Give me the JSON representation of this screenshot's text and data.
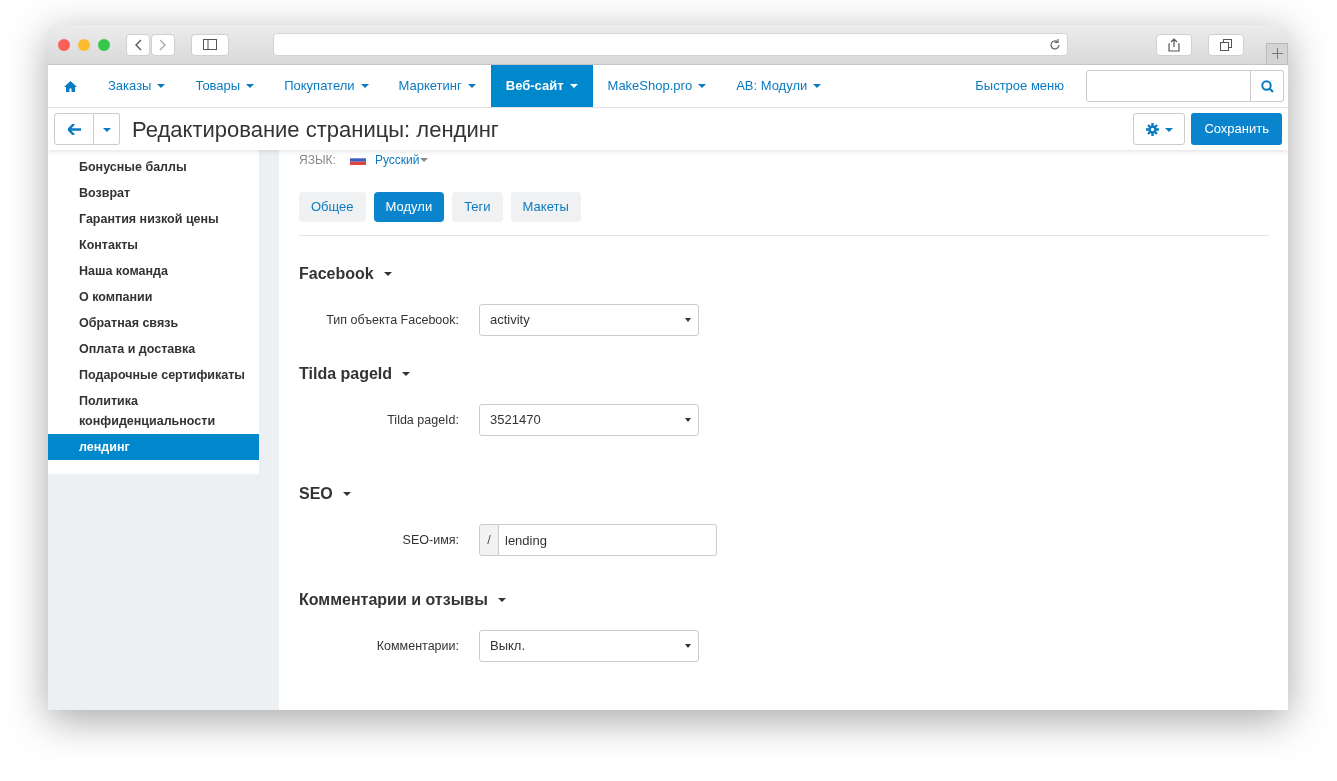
{
  "nav": {
    "items": [
      {
        "label": "Заказы",
        "selected": false
      },
      {
        "label": "Товары",
        "selected": false
      },
      {
        "label": "Покупатели",
        "selected": false
      },
      {
        "label": "Маркетинг",
        "selected": false
      },
      {
        "label": "Веб-сайт",
        "selected": true
      },
      {
        "label": "MakeShop.pro",
        "selected": false
      },
      {
        "label": "АВ: Модули",
        "selected": false
      }
    ],
    "quick_menu": "Быстрое меню"
  },
  "toolbar": {
    "title": "Редактирование страницы: лендинг",
    "save": "Сохранить"
  },
  "sidebar": {
    "items": [
      {
        "label": "Бонусные баллы",
        "selected": false
      },
      {
        "label": "Возврат",
        "selected": false
      },
      {
        "label": "Гарантия низкой цены",
        "selected": false
      },
      {
        "label": "Контакты",
        "selected": false
      },
      {
        "label": "Наша команда",
        "selected": false
      },
      {
        "label": "О компании",
        "selected": false
      },
      {
        "label": "Обратная связь",
        "selected": false
      },
      {
        "label": "Оплата и доставка",
        "selected": false
      },
      {
        "label": "Подарочные сертификаты",
        "selected": false
      },
      {
        "label": "Политика конфиденциальности",
        "selected": false
      },
      {
        "label": "лендинг",
        "selected": true
      }
    ]
  },
  "language": {
    "label": "ЯЗЫК:",
    "value": "Русский"
  },
  "tabs": [
    {
      "label": "Общее",
      "selected": false
    },
    {
      "label": "Модули",
      "selected": true
    },
    {
      "label": "Теги",
      "selected": false
    },
    {
      "label": "Макеты",
      "selected": false
    }
  ],
  "sections": [
    {
      "title": "Facebook",
      "fields": [
        {
          "kind": "select",
          "label": "Тип объекта Facebook:",
          "value": "activity"
        }
      ]
    },
    {
      "title": "Tilda pageId",
      "fields": [
        {
          "kind": "select",
          "label": "Tilda pageId:",
          "value": "3521470"
        }
      ]
    },
    {
      "title": "SEO",
      "fields": [
        {
          "kind": "prefixed",
          "label": "SEO-имя:",
          "prefix": "/",
          "value": "lending"
        }
      ]
    },
    {
      "title": "Комментарии и отзывы",
      "fields": [
        {
          "kind": "select",
          "label": "Комментарии:",
          "value": "Выкл."
        }
      ]
    }
  ]
}
